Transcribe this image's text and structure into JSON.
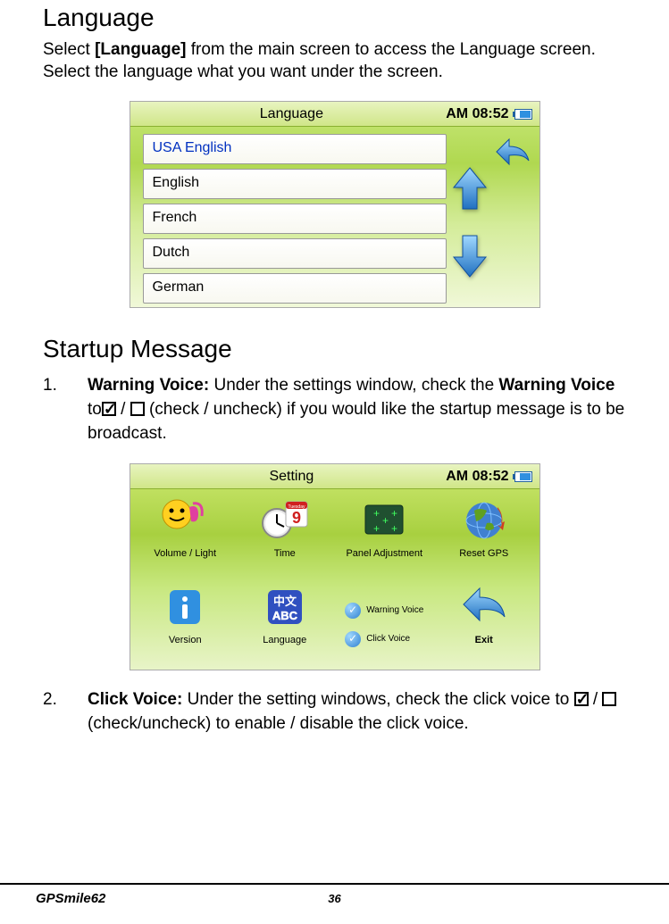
{
  "sections": {
    "language": {
      "title": "Language",
      "body_pre": "Select ",
      "body_bold": "[Language]",
      "body_post": " from the main screen to access the Language screen. Select the language what you want under the screen."
    },
    "startup": {
      "title": "Startup Message",
      "item1": {
        "num": "1.",
        "bold1": "Warning Voice:",
        "text1": " Under the settings window, check the ",
        "bold2": "Warning Voice",
        "text2": " to",
        "text3": " / ",
        "text4": " (check / uncheck) if you would like the startup message is to be broadcast."
      },
      "item2": {
        "num": "2.",
        "bold1": "Click Voice:",
        "text1": " Under the setting windows, check the click voice to ",
        "text2": " / ",
        "text3": " (check/uncheck) to enable / disable the click voice."
      }
    }
  },
  "screenshot1": {
    "title": "Language",
    "time": "AM 08:52",
    "items": [
      "USA English",
      "English",
      "French",
      "Dutch",
      "German"
    ]
  },
  "screenshot2": {
    "title": "Setting",
    "time": "AM 08:52",
    "cells": {
      "volume_light": "Volume / Light",
      "time": "Time",
      "panel_adjustment": "Panel Adjustment",
      "reset_gps": "Reset GPS",
      "version": "Version",
      "language": "Language",
      "warning_voice": "Warning Voice",
      "click_voice": "Click Voice",
      "exit": "Exit"
    },
    "lang_icon_top": "中文",
    "lang_icon_bottom": "ABC",
    "calendar_day": "Tuesday",
    "calendar_num": "9"
  },
  "footer": {
    "model": "GPSmile62",
    "page": "36"
  }
}
